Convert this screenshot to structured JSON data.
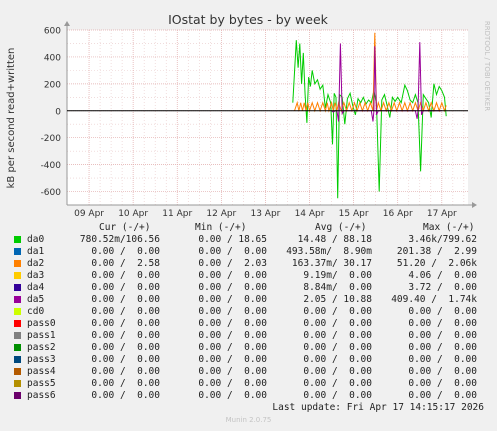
{
  "chart_data": {
    "type": "line",
    "title": "IOstat by bytes - by week",
    "ylabel": "kB per second read+written",
    "ylim": [
      -700,
      600
    ],
    "yticks": [
      600,
      400,
      200,
      0,
      -200,
      -400,
      -600
    ],
    "x_tick_labels": [
      "09 Apr",
      "10 Apr",
      "11 Apr",
      "12 Apr",
      "13 Apr",
      "14 Apr",
      "15 Apr",
      "16 Apr",
      "17 Apr"
    ],
    "xlim": [
      "08 Apr 12:00",
      "17 Apr 14:15"
    ],
    "grid": true,
    "side_label": "RRDTOOL / TOBI OETIKER",
    "series": [
      {
        "name": "da0",
        "color": "#00cc00",
        "points": [
          [
            13.62,
            60
          ],
          [
            13.7,
            525
          ],
          [
            13.74,
            320
          ],
          [
            13.78,
            500
          ],
          [
            13.82,
            200
          ],
          [
            13.86,
            430
          ],
          [
            13.9,
            120
          ],
          [
            13.94,
            -90
          ],
          [
            13.98,
            250
          ],
          [
            14.02,
            180
          ],
          [
            14.06,
            300
          ],
          [
            14.12,
            200
          ],
          [
            14.18,
            230
          ],
          [
            14.24,
            160
          ],
          [
            14.3,
            190
          ],
          [
            14.36,
            20
          ],
          [
            14.42,
            120
          ],
          [
            14.48,
            60
          ],
          [
            14.52,
            -250
          ],
          [
            14.56,
            130
          ],
          [
            14.6,
            100
          ],
          [
            14.64,
            -650
          ],
          [
            14.68,
            120
          ],
          [
            14.74,
            100
          ],
          [
            14.8,
            -100
          ],
          [
            14.86,
            90
          ],
          [
            14.92,
            130
          ],
          [
            14.98,
            40
          ],
          [
            15.04,
            -30
          ],
          [
            15.1,
            90
          ],
          [
            15.16,
            60
          ],
          [
            15.22,
            100
          ],
          [
            15.28,
            50
          ],
          [
            15.34,
            80
          ],
          [
            15.4,
            60
          ],
          [
            15.46,
            150
          ],
          [
            15.52,
            50
          ],
          [
            15.58,
            -600
          ],
          [
            15.64,
            80
          ],
          [
            15.7,
            120
          ],
          [
            15.76,
            40
          ],
          [
            15.82,
            -50
          ],
          [
            15.88,
            100
          ],
          [
            15.94,
            70
          ],
          [
            16.0,
            100
          ],
          [
            16.08,
            60
          ],
          [
            16.16,
            190
          ],
          [
            16.22,
            150
          ],
          [
            16.28,
            80
          ],
          [
            16.34,
            60
          ],
          [
            16.4,
            120
          ],
          [
            16.46,
            60
          ],
          [
            16.52,
            -450
          ],
          [
            16.58,
            120
          ],
          [
            16.64,
            90
          ],
          [
            16.7,
            60
          ],
          [
            16.76,
            -50
          ],
          [
            16.82,
            200
          ],
          [
            16.88,
            120
          ],
          [
            16.94,
            180
          ],
          [
            17.0,
            150
          ],
          [
            17.06,
            100
          ],
          [
            17.1,
            -40
          ]
        ]
      },
      {
        "name": "da2",
        "color": "#ff8000",
        "points": [
          [
            13.66,
            0
          ],
          [
            13.72,
            60
          ],
          [
            13.76,
            0
          ],
          [
            13.8,
            60
          ],
          [
            13.84,
            0
          ],
          [
            13.88,
            60
          ],
          [
            13.92,
            0
          ],
          [
            13.96,
            60
          ],
          [
            14.0,
            0
          ],
          [
            14.06,
            60
          ],
          [
            14.12,
            0
          ],
          [
            14.18,
            60
          ],
          [
            14.24,
            0
          ],
          [
            14.3,
            60
          ],
          [
            14.36,
            0
          ],
          [
            14.4,
            60
          ],
          [
            14.44,
            0
          ],
          [
            14.5,
            60
          ],
          [
            14.54,
            0
          ],
          [
            14.58,
            60
          ],
          [
            14.62,
            0
          ],
          [
            14.66,
            60
          ],
          [
            14.72,
            0
          ],
          [
            14.78,
            60
          ],
          [
            14.84,
            0
          ],
          [
            14.9,
            60
          ],
          [
            14.96,
            0
          ],
          [
            15.02,
            60
          ],
          [
            15.08,
            0
          ],
          [
            15.14,
            60
          ],
          [
            15.2,
            0
          ],
          [
            15.26,
            60
          ],
          [
            15.32,
            0
          ],
          [
            15.38,
            60
          ],
          [
            15.44,
            0
          ],
          [
            15.48,
            580
          ],
          [
            15.52,
            0
          ],
          [
            15.56,
            60
          ],
          [
            15.62,
            0
          ],
          [
            15.68,
            60
          ],
          [
            15.74,
            0
          ],
          [
            15.8,
            60
          ],
          [
            15.86,
            0
          ],
          [
            15.92,
            60
          ],
          [
            15.98,
            0
          ],
          [
            16.04,
            60
          ],
          [
            16.1,
            0
          ],
          [
            16.16,
            60
          ],
          [
            16.22,
            0
          ],
          [
            16.28,
            60
          ],
          [
            16.34,
            0
          ],
          [
            16.4,
            60
          ],
          [
            16.46,
            0
          ],
          [
            16.52,
            60
          ],
          [
            16.58,
            0
          ],
          [
            16.64,
            60
          ],
          [
            16.7,
            0
          ],
          [
            16.76,
            60
          ],
          [
            16.82,
            0
          ],
          [
            16.88,
            60
          ],
          [
            16.94,
            0
          ],
          [
            17.0,
            60
          ],
          [
            17.06,
            0
          ],
          [
            17.1,
            40
          ]
        ]
      },
      {
        "name": "da5",
        "color": "#990099",
        "points": [
          [
            14.5,
            0
          ],
          [
            14.54,
            -10
          ],
          [
            14.58,
            0
          ],
          [
            14.62,
            0
          ],
          [
            14.66,
            -80
          ],
          [
            14.7,
            500
          ],
          [
            14.74,
            -20
          ],
          [
            14.78,
            0
          ],
          [
            15.4,
            0
          ],
          [
            15.44,
            -80
          ],
          [
            15.46,
            0
          ],
          [
            15.48,
            480
          ],
          [
            15.52,
            -30
          ],
          [
            15.56,
            0
          ],
          [
            16.4,
            0
          ],
          [
            16.44,
            -60
          ],
          [
            16.46,
            0
          ],
          [
            16.5,
            510
          ],
          [
            16.54,
            -30
          ],
          [
            16.58,
            0
          ],
          [
            17.0,
            0
          ]
        ]
      }
    ]
  },
  "legend": {
    "headers": {
      "cur": "Cur (-/+)",
      "min": "Min (-/+)",
      "avg": "Avg (-/+)",
      "max": "Max (-/+)"
    },
    "rows": [
      {
        "name": "da0",
        "color": "#00cc00",
        "cur": "780.52m/106.56",
        "min": "0.00 / 18.65",
        "avg": "14.48 / 88.18",
        "max": "3.46k/799.62"
      },
      {
        "name": "da1",
        "color": "#0066b3",
        "cur": "0.00 /  0.00",
        "min": "0.00 /  0.00",
        "avg": "493.58m/  8.90m",
        "max": "201.38 /  2.99"
      },
      {
        "name": "da2",
        "color": "#ff8000",
        "cur": "0.00 /  2.58",
        "min": "0.00 /  2.03",
        "avg": "163.37m/ 30.17",
        "max": "51.20 /  2.06k"
      },
      {
        "name": "da3",
        "color": "#ffcc00",
        "cur": "0.00 /  0.00",
        "min": "0.00 /  0.00",
        "avg": "9.19m/  0.00",
        "max": "4.06 /  0.00"
      },
      {
        "name": "da4",
        "color": "#330099",
        "cur": "0.00 /  0.00",
        "min": "0.00 /  0.00",
        "avg": "8.84m/  0.00",
        "max": "3.72 /  0.00"
      },
      {
        "name": "da5",
        "color": "#990099",
        "cur": "0.00 /  0.00",
        "min": "0.00 /  0.00",
        "avg": "2.05 / 10.88",
        "max": "409.40 /  1.74k"
      },
      {
        "name": "cd0",
        "color": "#ccff00",
        "cur": "0.00 /  0.00",
        "min": "0.00 /  0.00",
        "avg": "0.00 /  0.00",
        "max": "0.00 /  0.00"
      },
      {
        "name": "pass0",
        "color": "#ff0000",
        "cur": "0.00 /  0.00",
        "min": "0.00 /  0.00",
        "avg": "0.00 /  0.00",
        "max": "0.00 /  0.00"
      },
      {
        "name": "pass1",
        "color": "#808080",
        "cur": "0.00 /  0.00",
        "min": "0.00 /  0.00",
        "avg": "0.00 /  0.00",
        "max": "0.00 /  0.00"
      },
      {
        "name": "pass2",
        "color": "#008f00",
        "cur": "0.00 /  0.00",
        "min": "0.00 /  0.00",
        "avg": "0.00 /  0.00",
        "max": "0.00 /  0.00"
      },
      {
        "name": "pass3",
        "color": "#00487d",
        "cur": "0.00 /  0.00",
        "min": "0.00 /  0.00",
        "avg": "0.00 /  0.00",
        "max": "0.00 /  0.00"
      },
      {
        "name": "pass4",
        "color": "#b35a00",
        "cur": "0.00 /  0.00",
        "min": "0.00 /  0.00",
        "avg": "0.00 /  0.00",
        "max": "0.00 /  0.00"
      },
      {
        "name": "pass5",
        "color": "#b38f00",
        "cur": "0.00 /  0.00",
        "min": "0.00 /  0.00",
        "avg": "0.00 /  0.00",
        "max": "0.00 /  0.00"
      },
      {
        "name": "pass6",
        "color": "#6b006b",
        "cur": "0.00 /  0.00",
        "min": "0.00 /  0.00",
        "avg": "0.00 /  0.00",
        "max": "0.00 /  0.00"
      }
    ],
    "last_update": "Last update: Fri Apr 17 14:15:17 2026",
    "footer": "Munin 2.0.75"
  }
}
